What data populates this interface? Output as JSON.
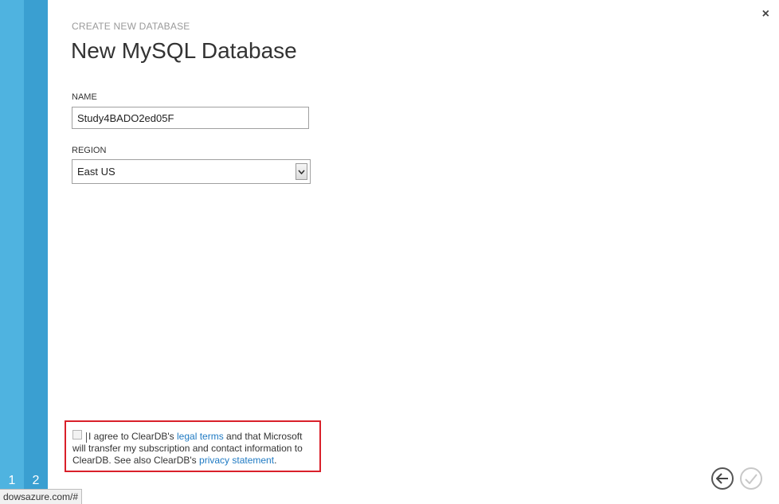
{
  "wizard": {
    "steps": [
      "1",
      "2"
    ],
    "close_label": "×"
  },
  "header": {
    "subtitle": "CREATE NEW DATABASE",
    "title": "New MySQL Database"
  },
  "form": {
    "name_label": "NAME",
    "name_value": "Study4BADO2ed05F",
    "region_label": "REGION",
    "region_value": "East US"
  },
  "agreement": {
    "text_1": "I agree to ClearDB's ",
    "legal_link": "legal terms",
    "text_2": " and that Microsoft will transfer my subscription and contact information to ClearDB. See also ClearDB's ",
    "privacy_link": "privacy statement",
    "text_3": ".",
    "checked": false
  },
  "status_bar": {
    "url": "dowsazure.com/#"
  },
  "colors": {
    "strip_light": "#4fb3e0",
    "strip_dark": "#3a9fd1",
    "highlight_border": "#d9202a",
    "link": "#1f7ac3"
  }
}
